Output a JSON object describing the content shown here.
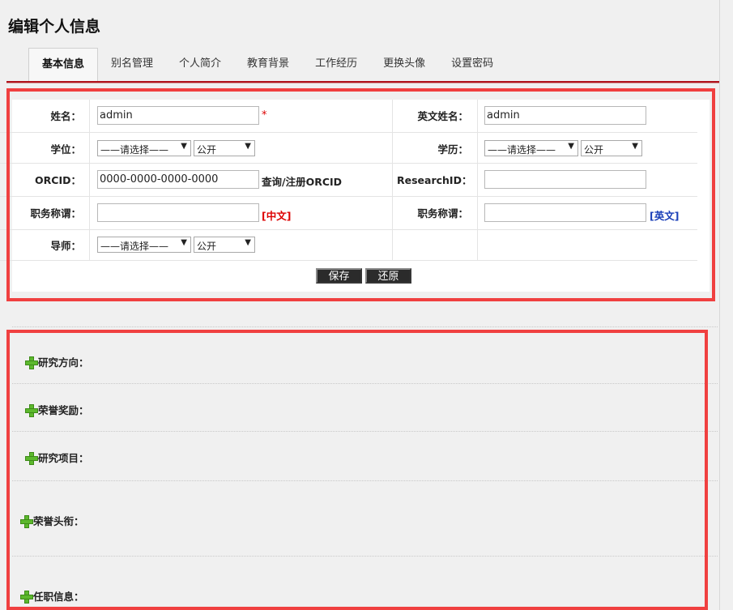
{
  "page": {
    "title": "编辑个人信息"
  },
  "tabs": [
    {
      "label": "基本信息",
      "active": true
    },
    {
      "label": "别名管理"
    },
    {
      "label": "个人简介"
    },
    {
      "label": "教育背景"
    },
    {
      "label": "工作经历"
    },
    {
      "label": "更换头像"
    },
    {
      "label": "设置密码"
    }
  ],
  "form": {
    "name": {
      "label": "姓名：",
      "value": "admin",
      "required_mark": "*"
    },
    "english_name": {
      "label": "英文姓名：",
      "value": "admin"
    },
    "degree": {
      "label": "学位：",
      "select": "——请选择——",
      "visibility": "公开"
    },
    "education": {
      "label": "学历：",
      "select": "——请选择——",
      "visibility": "公开"
    },
    "orcid": {
      "label": "ORCID：",
      "value": "0000-0000-0000-0000",
      "link": "查询/注册ORCID"
    },
    "researchid": {
      "label": "ResearchID：",
      "value": ""
    },
    "title_cn": {
      "label": "职务称谓：",
      "value": "",
      "tag": "[中文]"
    },
    "title_en": {
      "label": "职务称谓：",
      "value": "",
      "tag": "[英文]"
    },
    "mentor": {
      "label": "导师：",
      "select": "——请选择——",
      "visibility": "公开"
    },
    "save_label": "保存",
    "reset_label": "还原"
  },
  "sections": [
    {
      "label": "研究方向："
    },
    {
      "label": "荣誉奖励："
    },
    {
      "label": "研究项目："
    },
    {
      "label": "荣誉头衔："
    },
    {
      "label": "任职信息："
    }
  ],
  "colors": {
    "accent": "#b0121b",
    "highlight_box": "#f04040",
    "add_icon": "#5cb82d"
  }
}
